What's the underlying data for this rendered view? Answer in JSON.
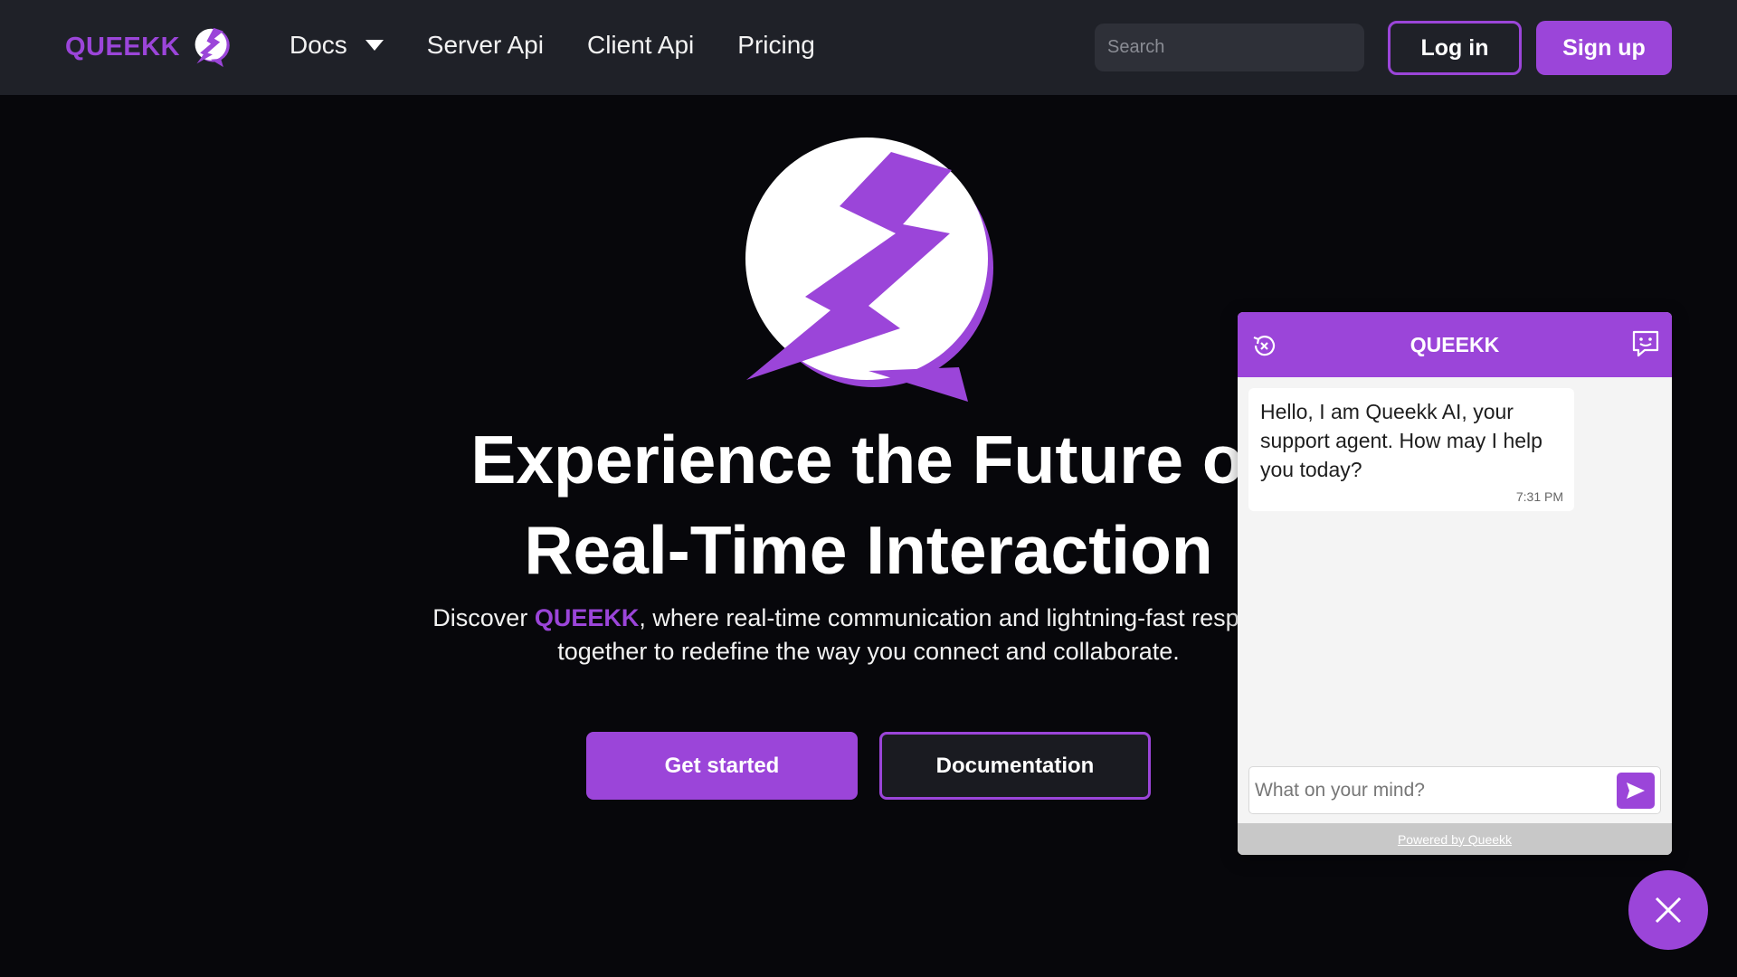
{
  "theme": {
    "accent": "#9b45d9",
    "background": "#07070b",
    "navbar": "#1f2128"
  },
  "nav": {
    "brand": "QUEEKK",
    "links": [
      {
        "label": "Docs",
        "icon": "caret-down-icon"
      },
      {
        "label": "Server Api"
      },
      {
        "label": "Client Api"
      },
      {
        "label": "Pricing"
      }
    ],
    "search_placeholder": "Search",
    "login_label": "Log in",
    "signup_label": "Sign up"
  },
  "hero": {
    "title_line1": "Experience the Future of",
    "title_line2": "Real-Time Interaction",
    "sub_prefix": "Discover ",
    "sub_highlight": "QUEEKK",
    "sub_line1_rest": ", where real-time communication and lightning-fast responses",
    "sub_line2": "together to redefine the way you connect and collaborate.",
    "primary_cta": "Get started",
    "secondary_cta": "Documentation"
  },
  "chat": {
    "title": "QUEEKK",
    "left_icon": "close-history-icon",
    "right_icon": "chat-smile-icon",
    "messages": [
      {
        "text": "Hello, I am Queekk AI, your support agent. How may I help you today?",
        "time": "7:31 PM"
      }
    ],
    "input_placeholder": "What on your mind?",
    "send_icon": "send-icon",
    "footer": "Powered by Queekk"
  },
  "fab": {
    "icon": "close-icon"
  }
}
